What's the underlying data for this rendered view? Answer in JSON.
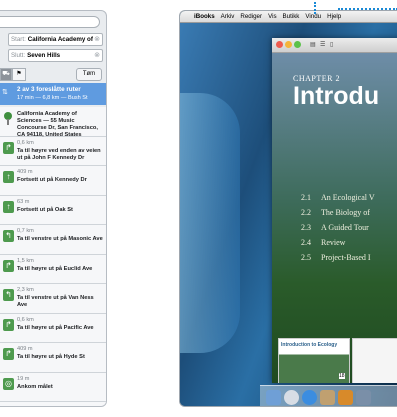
{
  "maps": {
    "start_label": "Start:",
    "start_value": "California Academy of",
    "end_label": "Slutt:",
    "end_value": "Seven Hills",
    "mode_car": "⛟",
    "mode_walk": "⚑",
    "swap_label": "Tøm",
    "route_summary_title": "2 av 3 foreslåtte ruter",
    "route_summary_sub": "17 min — 6,8 km — Bush St",
    "steps": [
      {
        "dist": "",
        "text": "California Academy of Sciences — 55 Music Concourse Dr, San Francisco, CA 94118, United States",
        "type": "start"
      },
      {
        "dist": "0,6 km",
        "text": "Ta til høyre ved enden av veien ut på John F Kennedy Dr",
        "type": "right"
      },
      {
        "dist": "409 m",
        "text": "Fortsett ut på Kennedy Dr",
        "type": "straight"
      },
      {
        "dist": "63 m",
        "text": "Fortsett ut på Oak St",
        "type": "straight"
      },
      {
        "dist": "0,7 km",
        "text": "Ta til venstre ut på Masonic Ave",
        "type": "left"
      },
      {
        "dist": "1,5 km",
        "text": "Ta til høyre ut på Euclid Ave",
        "type": "right"
      },
      {
        "dist": "2,3 km",
        "text": "Ta til venstre ut på Van Ness Ave",
        "type": "left"
      },
      {
        "dist": "0,6 km",
        "text": "Ta til høyre ut på Pacific Ave",
        "type": "right"
      },
      {
        "dist": "409 m",
        "text": "Ta til høyre ut på Hyde St",
        "type": "right"
      },
      {
        "dist": "19 m",
        "text": "Ankom målet",
        "type": "arrive"
      },
      {
        "dist": "",
        "text": "Seven Hills — 1550 Hyde St, San Francisco, CA 94109-3114, United States",
        "type": "end"
      }
    ]
  },
  "mac": {
    "menu": [
      "iBooks",
      "Arkiv",
      "Rediger",
      "Vis",
      "Butikk",
      "Vindu",
      "Hjelp"
    ],
    "chapter": "CHAPTER 2",
    "title": "Introdu",
    "toc": [
      {
        "n": "2.1",
        "t": "An Ecological V"
      },
      {
        "n": "2.2",
        "t": "The Biology of"
      },
      {
        "n": "2.3",
        "t": "A Guided Tour"
      },
      {
        "n": "2.4",
        "t": "Review"
      },
      {
        "n": "2.5",
        "t": "Project-Based I"
      }
    ],
    "thumb_label": "Introduction to Ecology",
    "thumb_page": "18"
  },
  "colors": {
    "route_blue": "#5f9be0",
    "sign_green": "#4e9a4e",
    "callout_blue": "#1a8ad6"
  }
}
